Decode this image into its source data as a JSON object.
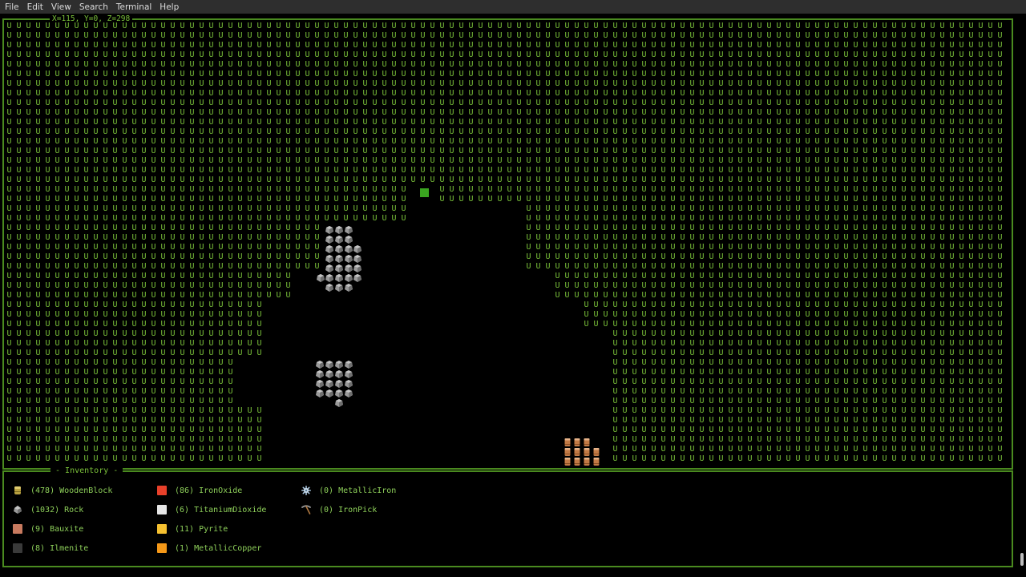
{
  "menu": [
    "File",
    "Edit",
    "View",
    "Search",
    "Terminal",
    "Help"
  ],
  "hud": {
    "coords": "X=115, Y=0, Z=298"
  },
  "map": {
    "tile_glyph": "U",
    "tile_color": "#7bc23a",
    "cursor_color": "#3aa520",
    "frame_color": "#4a8a1f"
  },
  "inventory": {
    "title": "Inventory",
    "items": [
      {
        "label": "(478) WoodenBlock",
        "icon": "wooden-block-icon"
      },
      {
        "label": "(1032) Rock",
        "icon": "rock-icon"
      },
      {
        "label": "(9) Bauxite",
        "icon": "bauxite-icon",
        "color": "#c87a5f"
      },
      {
        "label": "(8) Ilmenite",
        "icon": "ilmenite-icon",
        "color": "#3a3a3a"
      },
      {
        "label": "(86) IronOxide",
        "icon": "iron-oxide-icon",
        "color": "#e8402a"
      },
      {
        "label": "(6) TitaniumDioxide",
        "icon": "titanium-dioxide-icon",
        "color": "#e6e6e6"
      },
      {
        "label": "(11) Pyrite",
        "icon": "pyrite-icon",
        "color": "#f5c030"
      },
      {
        "label": "(1) MetallicCopper",
        "icon": "metallic-copper-icon",
        "color": "#f59818"
      },
      {
        "label": "(0) MetallicIron",
        "icon": "metallic-iron-icon"
      },
      {
        "label": "(0) IronPick",
        "icon": "iron-pick-icon"
      }
    ]
  }
}
